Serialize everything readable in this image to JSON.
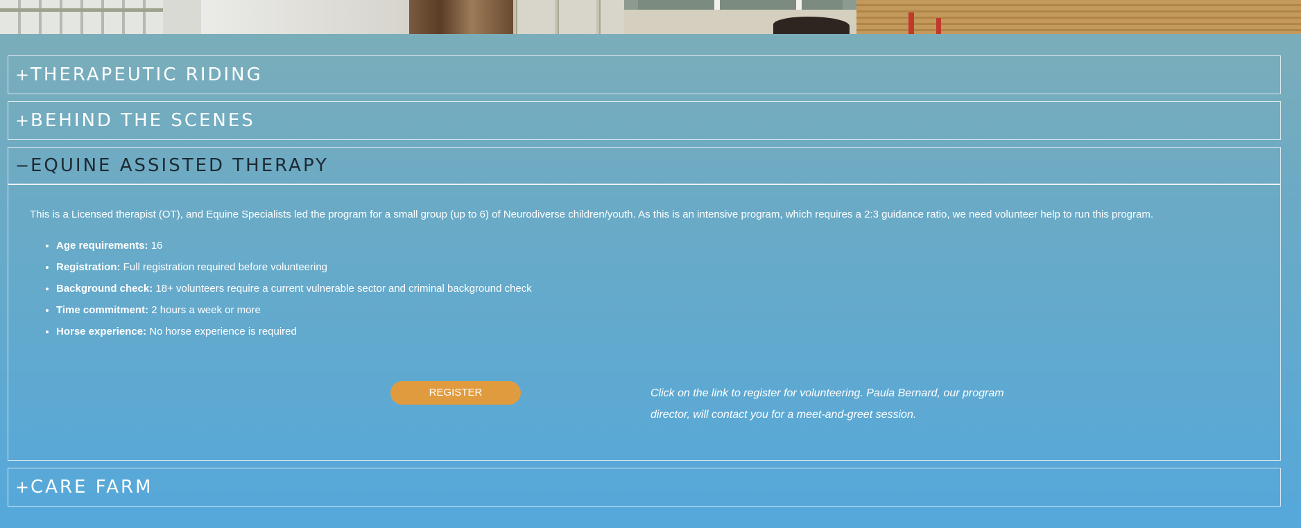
{
  "accordion": {
    "items": [
      {
        "symbol": "+",
        "title": "THERAPEUTIC RIDING"
      },
      {
        "symbol": "+",
        "title": "BEHIND THE SCENES"
      },
      {
        "symbol": "−",
        "title": "EQUINE ASSISTED THERAPY"
      },
      {
        "symbol": "+",
        "title": "CARE FARM"
      }
    ],
    "open": {
      "intro": "This is a Licensed therapist (OT), and Equine Specialists led the program for a small group (up to 6) of Neurodiverse children/youth. As this is an intensive program, which requires a 2:3 guidance ratio, we need volunteer help to run this program.",
      "requirements": [
        {
          "key": "Age requirements:",
          "value": " 16"
        },
        {
          "key": "Registration:",
          "value": " Full registration required before volunteering"
        },
        {
          "key": "Background check:",
          "value": " 18+ volunteers require a current vulnerable sector and criminal background check"
        },
        {
          "key": "Time commitment:",
          "value": " 2 hours a week or more"
        },
        {
          "key": "Horse experience:",
          "value": " No horse experience is required"
        }
      ],
      "register_label": "REGISTER",
      "register_note": "Click on the link to register for volunteering. Paula Bernard, our program director, will contact you for a meet-and-greet session."
    }
  },
  "colors": {
    "register_button": "#e19b3f",
    "background_top": "#7eaeb7",
    "background_bottom": "#55a8db",
    "open_header_text": "#1e2a33"
  }
}
